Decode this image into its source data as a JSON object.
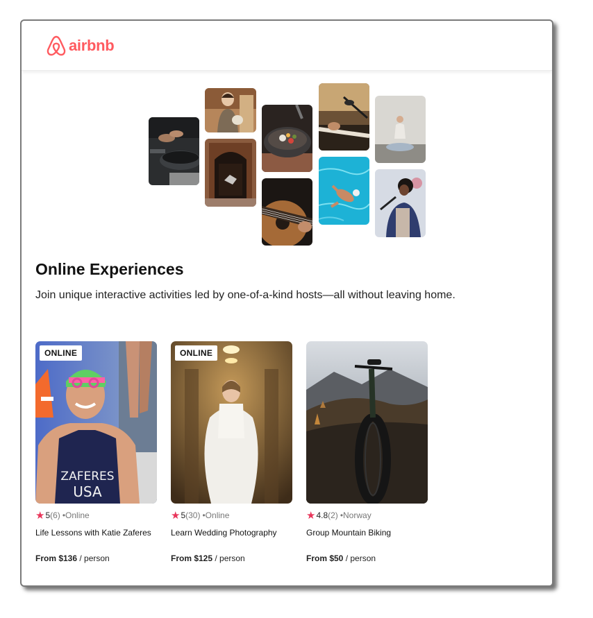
{
  "brand": {
    "name": "airbnb",
    "color": "#ff5a5f"
  },
  "hero": {
    "title": "Online Experiences",
    "subtitle": "Join unique interactive activities led by one-of-a-kind hosts—all without leaving home."
  },
  "collage": [
    {
      "subject": "cooking pans"
    },
    {
      "subject": "woman with cat"
    },
    {
      "subject": "dancer in doorway"
    },
    {
      "subject": "bowl of food"
    },
    {
      "subject": "acoustic guitar"
    },
    {
      "subject": "microphone and keyboard"
    },
    {
      "subject": "swimmer in pool"
    },
    {
      "subject": "yoga meditation"
    },
    {
      "subject": "singer with microphone"
    }
  ],
  "cards": [
    {
      "badge": "ONLINE",
      "rating": "5",
      "reviews": "(6)",
      "location": "•Online",
      "name": "Life Lessons with Katie Zaferes",
      "price_prefix": "From $136",
      "price_suffix": " / person",
      "shirt_text": "ZAFERES USA"
    },
    {
      "badge": "ONLINE",
      "rating": "5",
      "reviews": "(30)",
      "location": "•Online",
      "name": "Learn Wedding Photography",
      "price_prefix": "From $125",
      "price_suffix": " / person"
    },
    {
      "badge": "",
      "rating": "4.8",
      "reviews": "(2)",
      "location": "•Norway",
      "name": "Group Mountain Biking",
      "price_prefix": "From $50",
      "price_suffix": " / person"
    }
  ],
  "colors": {
    "star": "#e8355a",
    "muted": "#777777"
  }
}
